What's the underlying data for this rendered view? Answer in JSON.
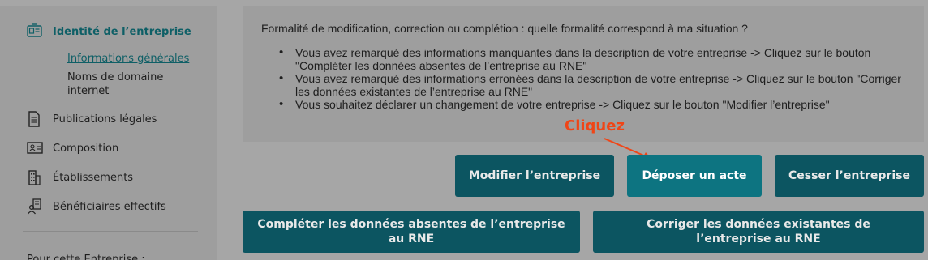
{
  "sidebar": {
    "items": [
      {
        "label": "Identité de l’entreprise",
        "icon": "id-card-icon"
      },
      {
        "label": "Publications légales",
        "icon": "document-icon"
      },
      {
        "label": "Composition",
        "icon": "people-card-icon"
      },
      {
        "label": "Établissements",
        "icon": "building-icon"
      },
      {
        "label": "Bénéficiaires effectifs",
        "icon": "beneficiaries-icon"
      }
    ],
    "subitems": [
      {
        "label": "Informations générales"
      },
      {
        "label": "Noms de domaine internet"
      }
    ],
    "footer_label": "Pour cette Entreprise :"
  },
  "info": {
    "question": "Formalité de modification, correction ou complétion : quelle formalité correspond à ma situation ?",
    "bullets": [
      "Vous avez remarqué des informations manquantes dans la description de votre entreprise -> Cliquez sur le bouton \"Compléter les données absentes de l’entreprise au RNE\"",
      "Vous avez remarqué des informations erronées dans la description de votre entreprise -> Cliquez sur le bouton \"Corriger les données existantes de l’entreprise au RNE\"",
      "Vous souhaitez déclarer un changement de votre entreprise -> Cliquez sur le bouton \"Modifier l’entreprise\""
    ]
  },
  "annotation": {
    "label": "Cliquez",
    "color": "#f04517"
  },
  "actions": {
    "modifier": "Modifier l’entreprise",
    "deposer": "Déposer un acte",
    "cesser": "Cesser l’entreprise",
    "completer": "Compléter les données absentes de l’entreprise au RNE",
    "corriger": "Corriger les données existantes de l’entreprise au RNE"
  },
  "colors": {
    "button": "#0c5561",
    "button_highlight": "#0d7481",
    "accent_text": "#0e5f66"
  }
}
